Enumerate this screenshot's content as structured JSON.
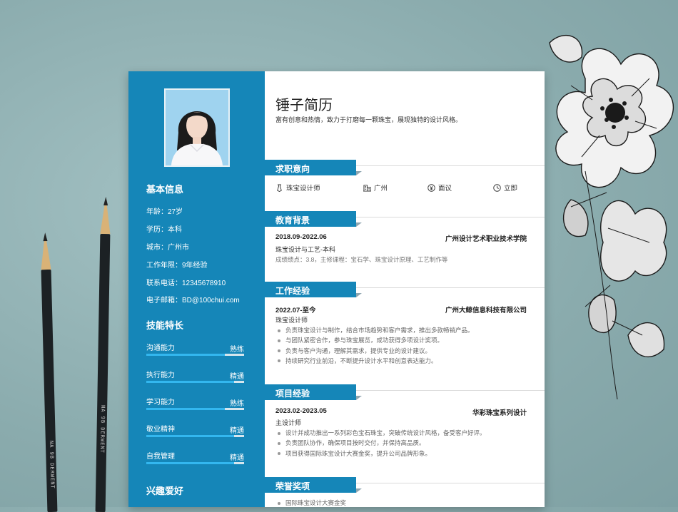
{
  "resume": {
    "name_title": "锤子简历",
    "slogan": "富有创意和热情，致力于打磨每一颗珠宝，展现独特的设计风格。",
    "sidebar": {
      "basic_heading": "基本信息",
      "basic_items": [
        "年龄：27岁",
        "学历：本科",
        "城市：广州市",
        "工作年限：9年经验",
        "联系电话：12345678910",
        "电子邮箱：BD@100chui.com"
      ],
      "skills_heading": "技能特长",
      "skills": [
        {
          "name": "沟通能力",
          "level": "熟练",
          "fill": 0.8
        },
        {
          "name": "执行能力",
          "level": "精通",
          "fill": 0.9
        },
        {
          "name": "学习能力",
          "level": "熟练",
          "fill": 0.8
        },
        {
          "name": "敬业精神",
          "level": "精通",
          "fill": 0.9
        },
        {
          "name": "自我管理",
          "level": "精通",
          "fill": 0.9
        }
      ],
      "hobby_heading": "兴趣爱好"
    },
    "sections": {
      "intent": "求职意向",
      "education": "教育背景",
      "work": "工作经验",
      "project": "项目经验",
      "honors": "荣誉奖项"
    },
    "intent": {
      "position": "珠宝设计师",
      "city": "广州",
      "salary": "面议",
      "availability": "立即"
    },
    "education": {
      "period": "2018.09-2022.06",
      "school": "广州设计艺术职业技术学院",
      "major": "珠宝设计与工艺-本科",
      "details": "成绩绩点：3.8，主修课程：宝石学、珠宝设计原理、工艺制作等"
    },
    "work": {
      "period": "2022.07-至今",
      "company": "广州大鲸信息科技有限公司",
      "role": "珠宝设计师",
      "bullets": [
        "负责珠宝设计与制作，结合市场趋势和客户需求，推出多款畅销产品。",
        "与团队紧密合作，参与珠宝展览，成功获得多项设计奖项。",
        "负责与客户沟通，理解其需求，提供专业的设计建议。",
        "持续研究行业前沿，不断提升设计水平和创意表达能力。"
      ]
    },
    "project": {
      "period": "2023.02-2023.05",
      "name": "华彩珠宝系列设计",
      "role": "主设计师",
      "bullets": [
        "设计并成功推出一系列彩色宝石珠宝，突破传统设计风格，备受客户好评。",
        "负责团队协作，确保项目按时交付，并保持高品质。",
        "项目获得国际珠宝设计大赛金奖，提升公司品牌形象。"
      ]
    },
    "honors": {
      "bullets": [
        "国际珠宝设计大赛金奖"
      ]
    }
  },
  "decor": {
    "pencil_brand": "NA 9B DERWENT",
    "accent_color": "#1586b8",
    "skill_bar_color": "#33b7ef",
    "background_color": "#8fb0b2"
  }
}
